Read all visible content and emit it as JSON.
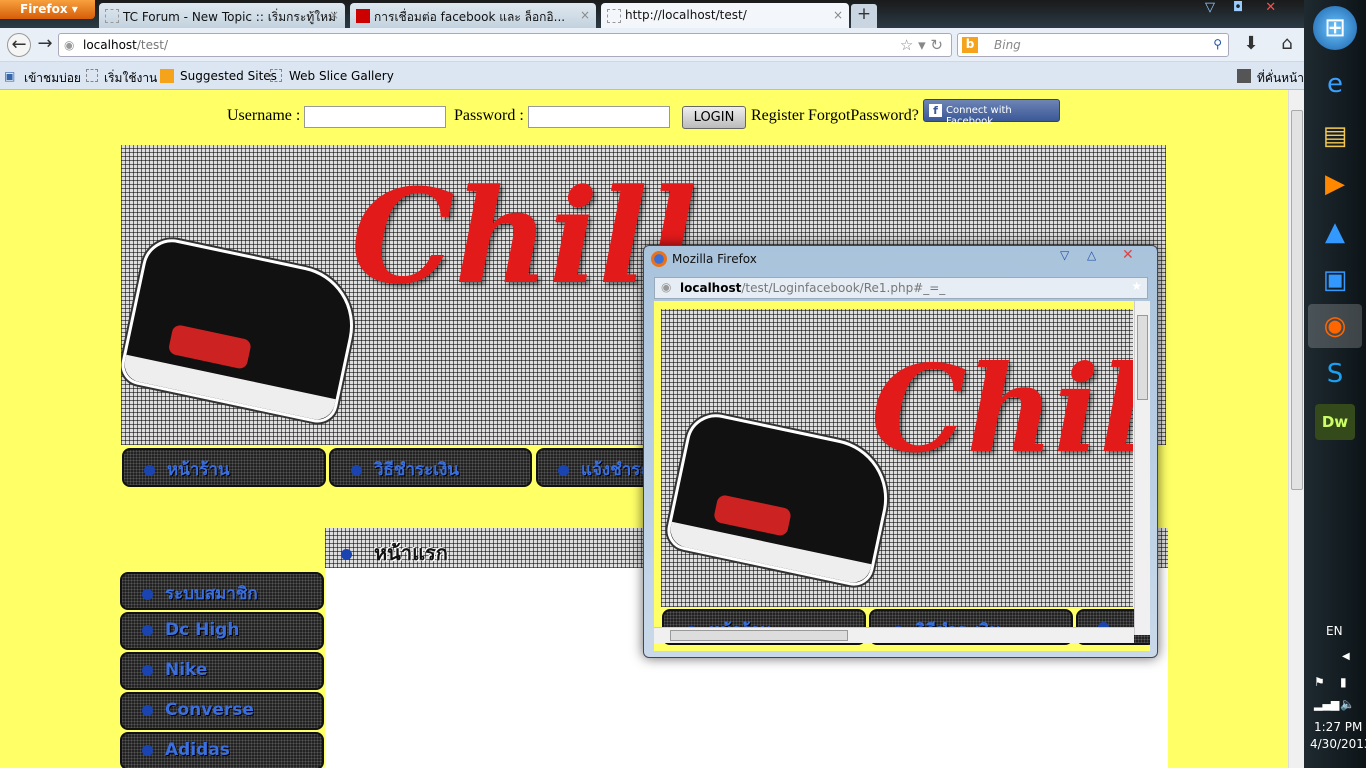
{
  "browser": {
    "menu_button": "Firefox",
    "tabs": [
      {
        "title": "TC Forum - New Topic :: เริ่มกระทู้ใหม่"
      },
      {
        "title": "การเชื่อมต่อ facebook และ ล็อกอิ..."
      },
      {
        "title": "http://localhost/test/"
      }
    ],
    "url_host": "localhost",
    "url_path": "/test/",
    "search_placeholder": "Bing",
    "bookmarks": [
      "เข้าชมบ่อย",
      "เริ่มใช้งาน",
      "Suggested Sites",
      "Web Slice Gallery"
    ],
    "bookmarks_right": "ที่คั่นหน้า"
  },
  "page": {
    "username_label": "Username :",
    "password_label": "Password :",
    "login_button": "LOGIN",
    "register_link": "Register",
    "forgot_link": "ForgotPassword?",
    "facebook_button": "Connect with Facebook",
    "banner_title": "Chill",
    "top_nav": [
      "หน้าร้าน",
      "วิธีชำระเงิน",
      "แจ้งชำระ"
    ],
    "content_heading": "หน้าแรก",
    "side_menu": [
      "ระบบสมาชิก",
      "Dc High",
      "Nike",
      "Converse",
      "Adidas"
    ]
  },
  "popup": {
    "title": "Mozilla Firefox",
    "url_host": "localhost",
    "url_path": "/test/Loginfacebook/Re1.php#_=_",
    "banner_title": "Chill",
    "nav": [
      "หน้าร้าน",
      "วิธีชำระเงิน"
    ]
  },
  "taskbar": {
    "language": "EN",
    "time": "1:27 PM",
    "date": "4/30/2013"
  }
}
